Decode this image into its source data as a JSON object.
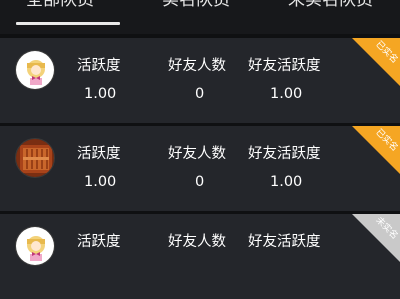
{
  "tabs": [
    {
      "label": "全部队员"
    },
    {
      "label": "实名队员"
    },
    {
      "label": "未实名队员"
    }
  ],
  "stat_labels": {
    "activity": "活跃度",
    "friends": "好友人数",
    "friend_activity": "好友活跃度"
  },
  "members": [
    {
      "avatar": "cartoon-girl-avatar",
      "activity": "1.00",
      "friends": "0",
      "friend_activity": "1.00",
      "badge": "已实名",
      "badge_color": "#f5a623"
    },
    {
      "avatar": "wooden-panel-avatar",
      "activity": "1.00",
      "friends": "0",
      "friend_activity": "1.00",
      "badge": "已实名",
      "badge_color": "#f5a623"
    },
    {
      "avatar": "cartoon-girl-avatar",
      "activity": "",
      "friends": "",
      "friend_activity": "",
      "badge": "未实名",
      "badge_color": "#c9c9c9"
    }
  ],
  "colors": {
    "background": "#0f1012",
    "card": "#24262b",
    "verified": "#f5a623",
    "unverified": "#c9c9c9"
  }
}
